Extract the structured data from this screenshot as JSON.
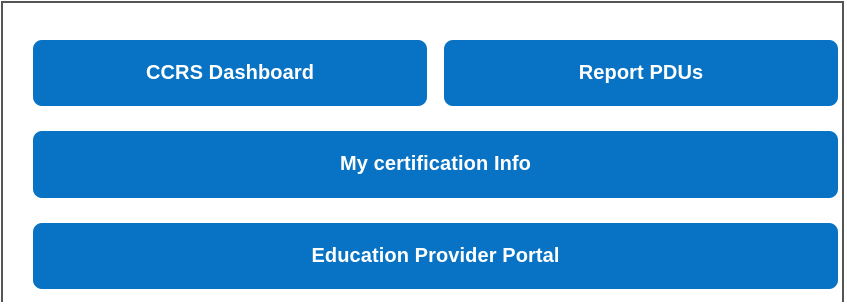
{
  "buttons": {
    "ccrs_dashboard": "CCRS Dashboard",
    "report_pdus": "Report PDUs",
    "my_certification_info": "My certification Info",
    "education_provider_portal": "Education Provider Portal"
  },
  "colors": {
    "button_background": "#0873c4",
    "button_text": "#ffffff",
    "panel_border": "#555555"
  }
}
